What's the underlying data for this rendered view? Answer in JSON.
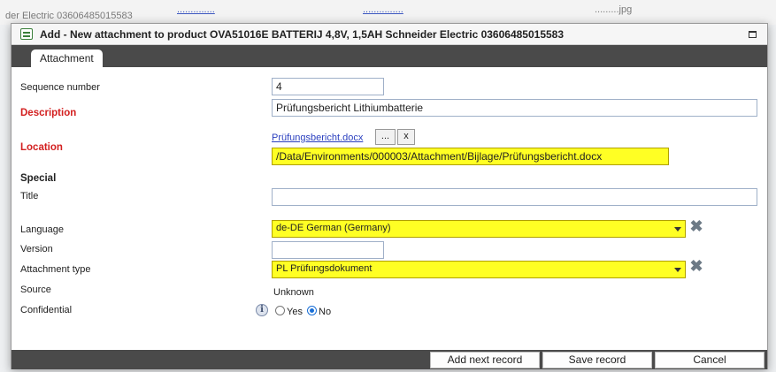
{
  "background": {
    "text_left": "der Electric 03606485015583",
    "link_mid": "..............",
    "link_right": "...............",
    "text_far_right": ".........jpg"
  },
  "dialog": {
    "title": "Add - New attachment to product OVA51016E BATTERIJ 4,8V, 1,5AH Schneider Electric 03606485015583",
    "tab_label": "Attachment"
  },
  "form": {
    "sequence_label": "Sequence number",
    "sequence_value": "4",
    "description_label": "Description",
    "description_value": "Prüfungsbericht Lithiumbatterie",
    "location_label": "Location",
    "location_file": "Prüfungsbericht.docx",
    "browse_label": "...",
    "remove_label": "x",
    "location_path": "/Data/Environments/000003/Attachment/Bijlage/Prüfungsbericht.docx",
    "special_label": "Special",
    "title_label": "Title",
    "title_value": "",
    "language_label": "Language",
    "language_value": "de-DE German (Germany)",
    "version_label": "Version",
    "version_value": "",
    "attachment_type_label": "Attachment type",
    "attachment_type_value": "PL Prüfungsdokument",
    "source_label": "Source",
    "source_value": "Unknown",
    "confidential_label": "Confidential",
    "yes_label": "Yes",
    "no_label": "No",
    "confidential_selected": "No"
  },
  "footer": {
    "add_next_label": "Add next record",
    "save_label": "Save record",
    "cancel_label": "Cancel"
  },
  "colors": {
    "highlight": "#ffff24",
    "required_label": "#d32020",
    "tab_bar": "#4a4a4a"
  },
  "icons": {
    "dialog": "form-window-icon",
    "maximize": "maximize-icon",
    "clear": "clear-x-icon",
    "info": "info-icon",
    "dropdown": "chevron-down-icon"
  }
}
